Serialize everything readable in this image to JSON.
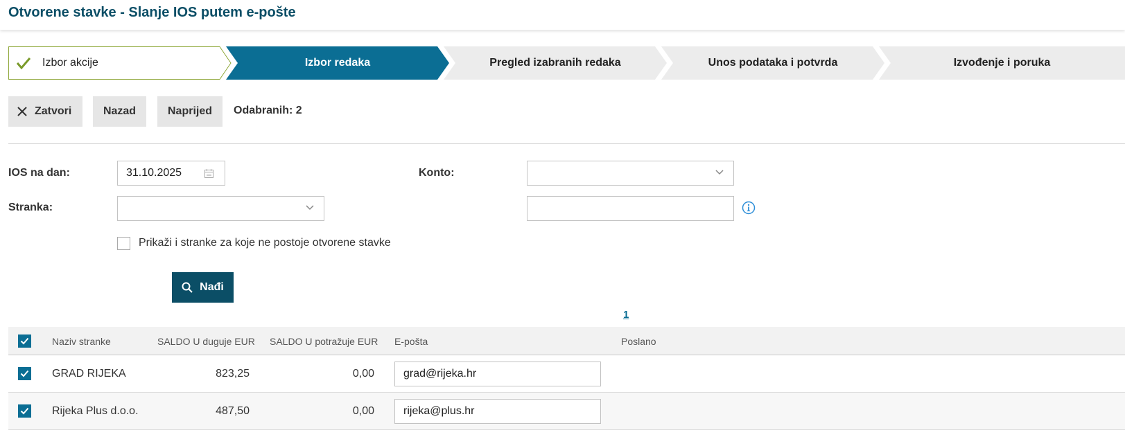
{
  "page_title": "Otvorene stavke - Slanje IOS putem e-pošte",
  "wizard": {
    "steps": [
      {
        "label": "Izbor akcije",
        "state": "done"
      },
      {
        "label": "Izbor redaka",
        "state": "active"
      },
      {
        "label": "Pregled izabranih redaka",
        "state": "pending"
      },
      {
        "label": "Unos podataka i potvrda",
        "state": "pending"
      },
      {
        "label": "Izvođenje i poruka",
        "state": "pending"
      }
    ]
  },
  "toolbar": {
    "close_label": "Zatvori",
    "back_label": "Nazad",
    "next_label": "Naprijed",
    "selected_label": "Odabranih: 2"
  },
  "form": {
    "ios_date_label": "IOS na dan:",
    "ios_date_value": "31.10.2025",
    "konto_label": "Konto:",
    "konto_value": "",
    "stranka_label": "Stranka:",
    "stranka_value": "",
    "extra_value": "",
    "show_all_label": "Prikaži i stranke za koje ne postoje otvorene stavke",
    "show_all_checked": false,
    "search_label": "Nađi"
  },
  "pagination": {
    "current_page": "1"
  },
  "table": {
    "headers": {
      "name": "Naziv stranke",
      "debit": "SALDO U duguje EUR",
      "credit": "SALDO U potražuje EUR",
      "email": "E-pošta",
      "sent": "Poslano"
    },
    "rows": [
      {
        "name": "GRAD RIJEKA",
        "debit": "823,25",
        "credit": "0,00",
        "email": "grad@rijeka.hr",
        "sent": "",
        "checked": true
      },
      {
        "name": "Rijeka Plus d.o.o.",
        "debit": "487,50",
        "credit": "0,00",
        "email": "rijeka@plus.hr",
        "sent": "",
        "checked": true
      }
    ]
  },
  "colors": {
    "primary": "#0b4e66",
    "active_step": "#0b6e94",
    "done_check": "#7a9a2a",
    "step_pending": "#ececec"
  }
}
